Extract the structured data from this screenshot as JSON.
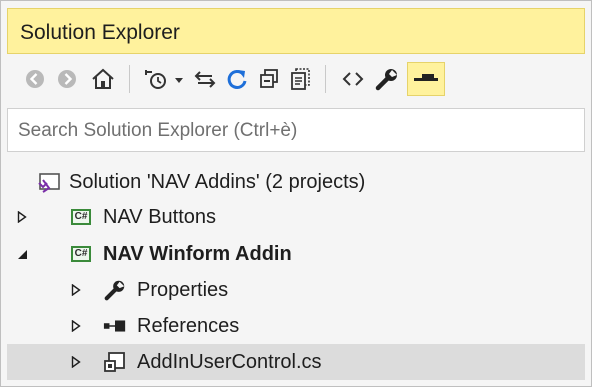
{
  "panel": {
    "title": "Solution Explorer"
  },
  "toolbar": {
    "buttons": [
      {
        "name": "back-button",
        "icon": "back-arrow-icon"
      },
      {
        "name": "forward-button",
        "icon": "forward-arrow-icon"
      },
      {
        "name": "home-button",
        "icon": "home-icon"
      },
      {
        "name": "pending-changes-filter-button",
        "icon": "clock-filter-icon"
      },
      {
        "name": "sync-with-active-document-button",
        "icon": "sync-arrows-icon"
      },
      {
        "name": "refresh-button",
        "icon": "refresh-icon"
      },
      {
        "name": "collapse-all-button",
        "icon": "collapse-all-icon"
      },
      {
        "name": "show-all-files-button",
        "icon": "show-all-files-icon"
      },
      {
        "name": "view-code-button",
        "icon": "code-brackets-icon"
      },
      {
        "name": "properties-button",
        "icon": "wrench-icon"
      },
      {
        "name": "auto-hide-pin-button",
        "icon": "pin-icon"
      }
    ],
    "colors": {
      "accent": "#1e6fd9",
      "pinned_bg": "#fff29d",
      "disabled": "#b0b0b0"
    }
  },
  "search": {
    "placeholder": "Search Solution Explorer (Ctrl+è)",
    "value": ""
  },
  "tree": {
    "items": [
      {
        "label": "Solution 'NAV Addins' (2 projects)",
        "icon": "solution-icon",
        "expander": "none",
        "level": 0,
        "bold": false,
        "selected": false
      },
      {
        "label": "NAV Buttons",
        "icon": "csharp-project-icon",
        "expander": "collapsed",
        "level": 0,
        "bold": false,
        "selected": false
      },
      {
        "label": "NAV Winform Addin",
        "icon": "csharp-project-icon",
        "expander": "expanded",
        "level": 0,
        "bold": true,
        "selected": false
      },
      {
        "label": "Properties",
        "icon": "wrench-icon",
        "expander": "collapsed",
        "level": 1,
        "bold": false,
        "selected": false
      },
      {
        "label": "References",
        "icon": "references-icon",
        "expander": "collapsed",
        "level": 1,
        "bold": false,
        "selected": false
      },
      {
        "label": "AddInUserControl.cs",
        "icon": "user-control-icon",
        "expander": "collapsed",
        "level": 1,
        "bold": false,
        "selected": true
      }
    ],
    "csharp_badge": "C#"
  }
}
